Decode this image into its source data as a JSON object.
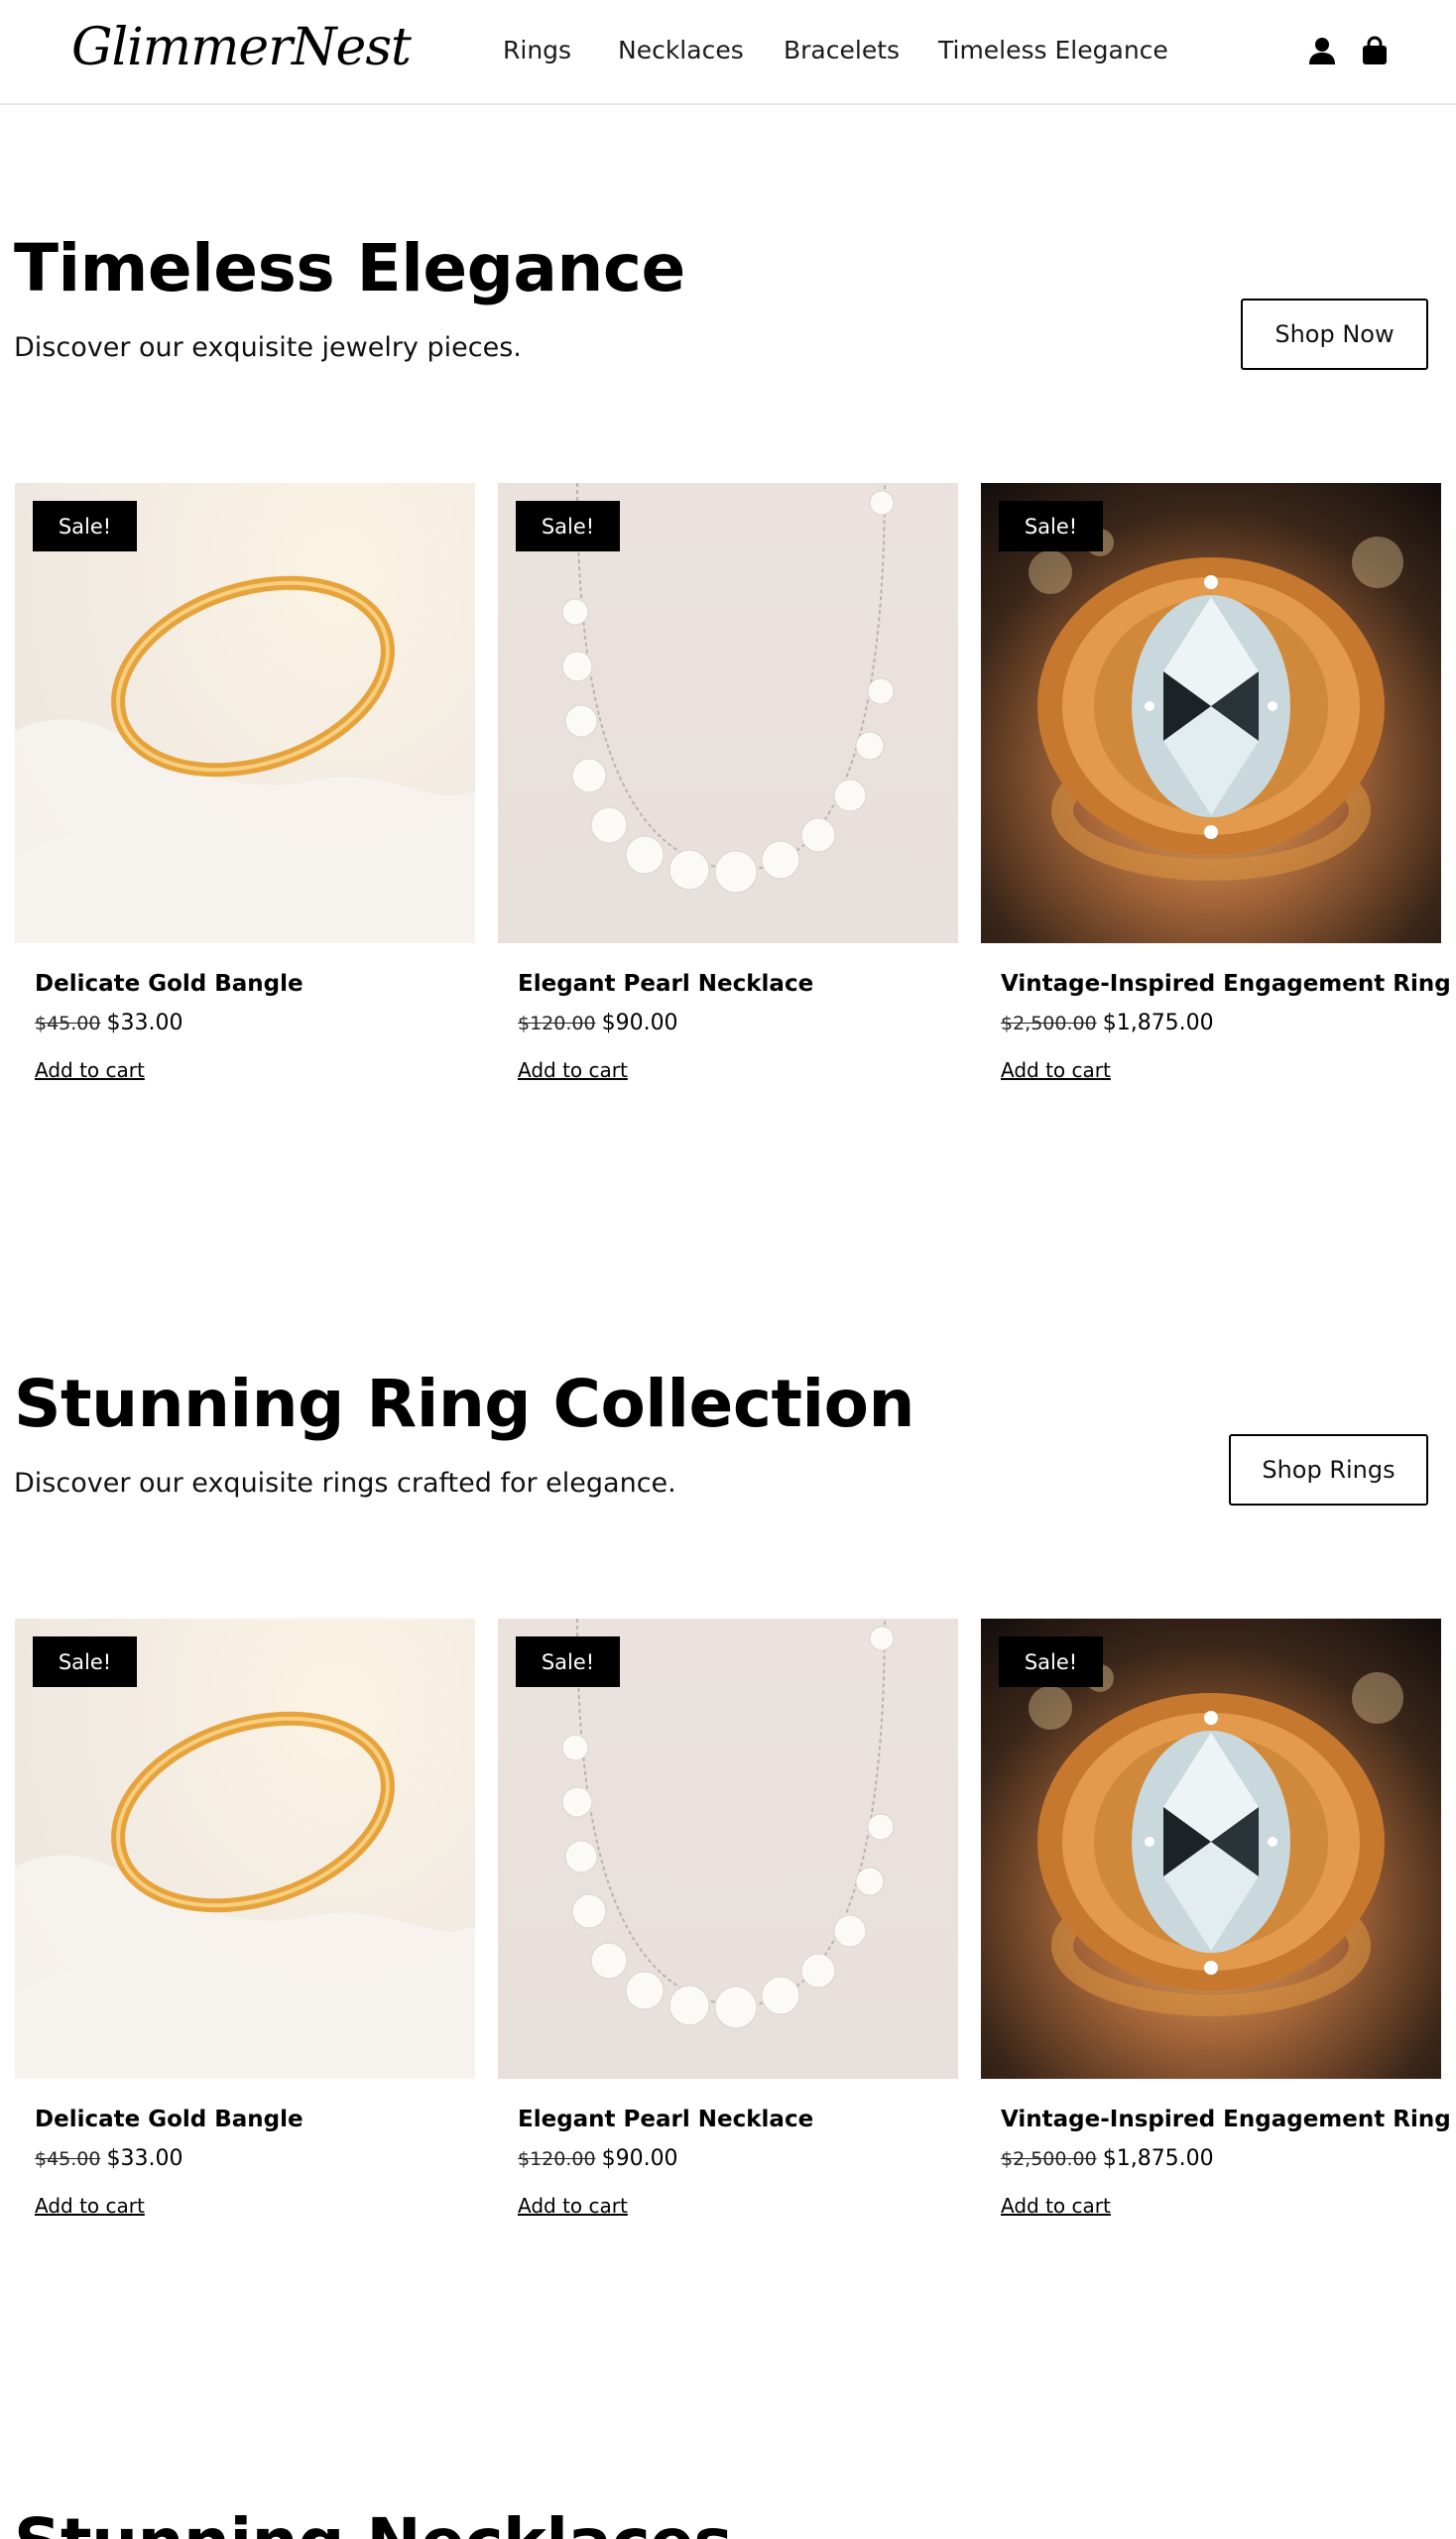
{
  "header": {
    "logo": "GlimmerNest",
    "nav": [
      "Rings",
      "Necklaces",
      "Bracelets",
      "Timeless Elegance"
    ],
    "icons": [
      "user-icon",
      "shopping-bag-icon"
    ]
  },
  "sections": [
    {
      "title": "Timeless Elegance",
      "subtitle": "Discover our exquisite jewelry pieces.",
      "button": "Shop Now",
      "products": [
        {
          "badge": "Sale!",
          "name": "Delicate Gold Bangle",
          "old_price": "$45.00",
          "price": "$33.00",
          "cta": "Add to cart"
        },
        {
          "badge": "Sale!",
          "name": "Elegant Pearl Necklace",
          "old_price": "$120.00",
          "price": "$90.00",
          "cta": "Add to cart"
        },
        {
          "badge": "Sale!",
          "name": "Vintage-Inspired Engagement Ring",
          "old_price": "$2,500.00",
          "price": "$1,875.00",
          "cta": "Add to cart"
        }
      ]
    },
    {
      "title": "Stunning Ring Collection",
      "subtitle": "Discover our exquisite rings crafted for elegance.",
      "button": "Shop Rings",
      "products": [
        {
          "badge": "Sale!",
          "name": "Delicate Gold Bangle",
          "old_price": "$45.00",
          "price": "$33.00",
          "cta": "Add to cart"
        },
        {
          "badge": "Sale!",
          "name": "Elegant Pearl Necklace",
          "old_price": "$120.00",
          "price": "$90.00",
          "cta": "Add to cart"
        },
        {
          "badge": "Sale!",
          "name": "Vintage-Inspired Engagement Ring",
          "old_price": "$2,500.00",
          "price": "$1,875.00",
          "cta": "Add to cart"
        }
      ]
    },
    {
      "title": "Stunning Necklaces"
    }
  ]
}
